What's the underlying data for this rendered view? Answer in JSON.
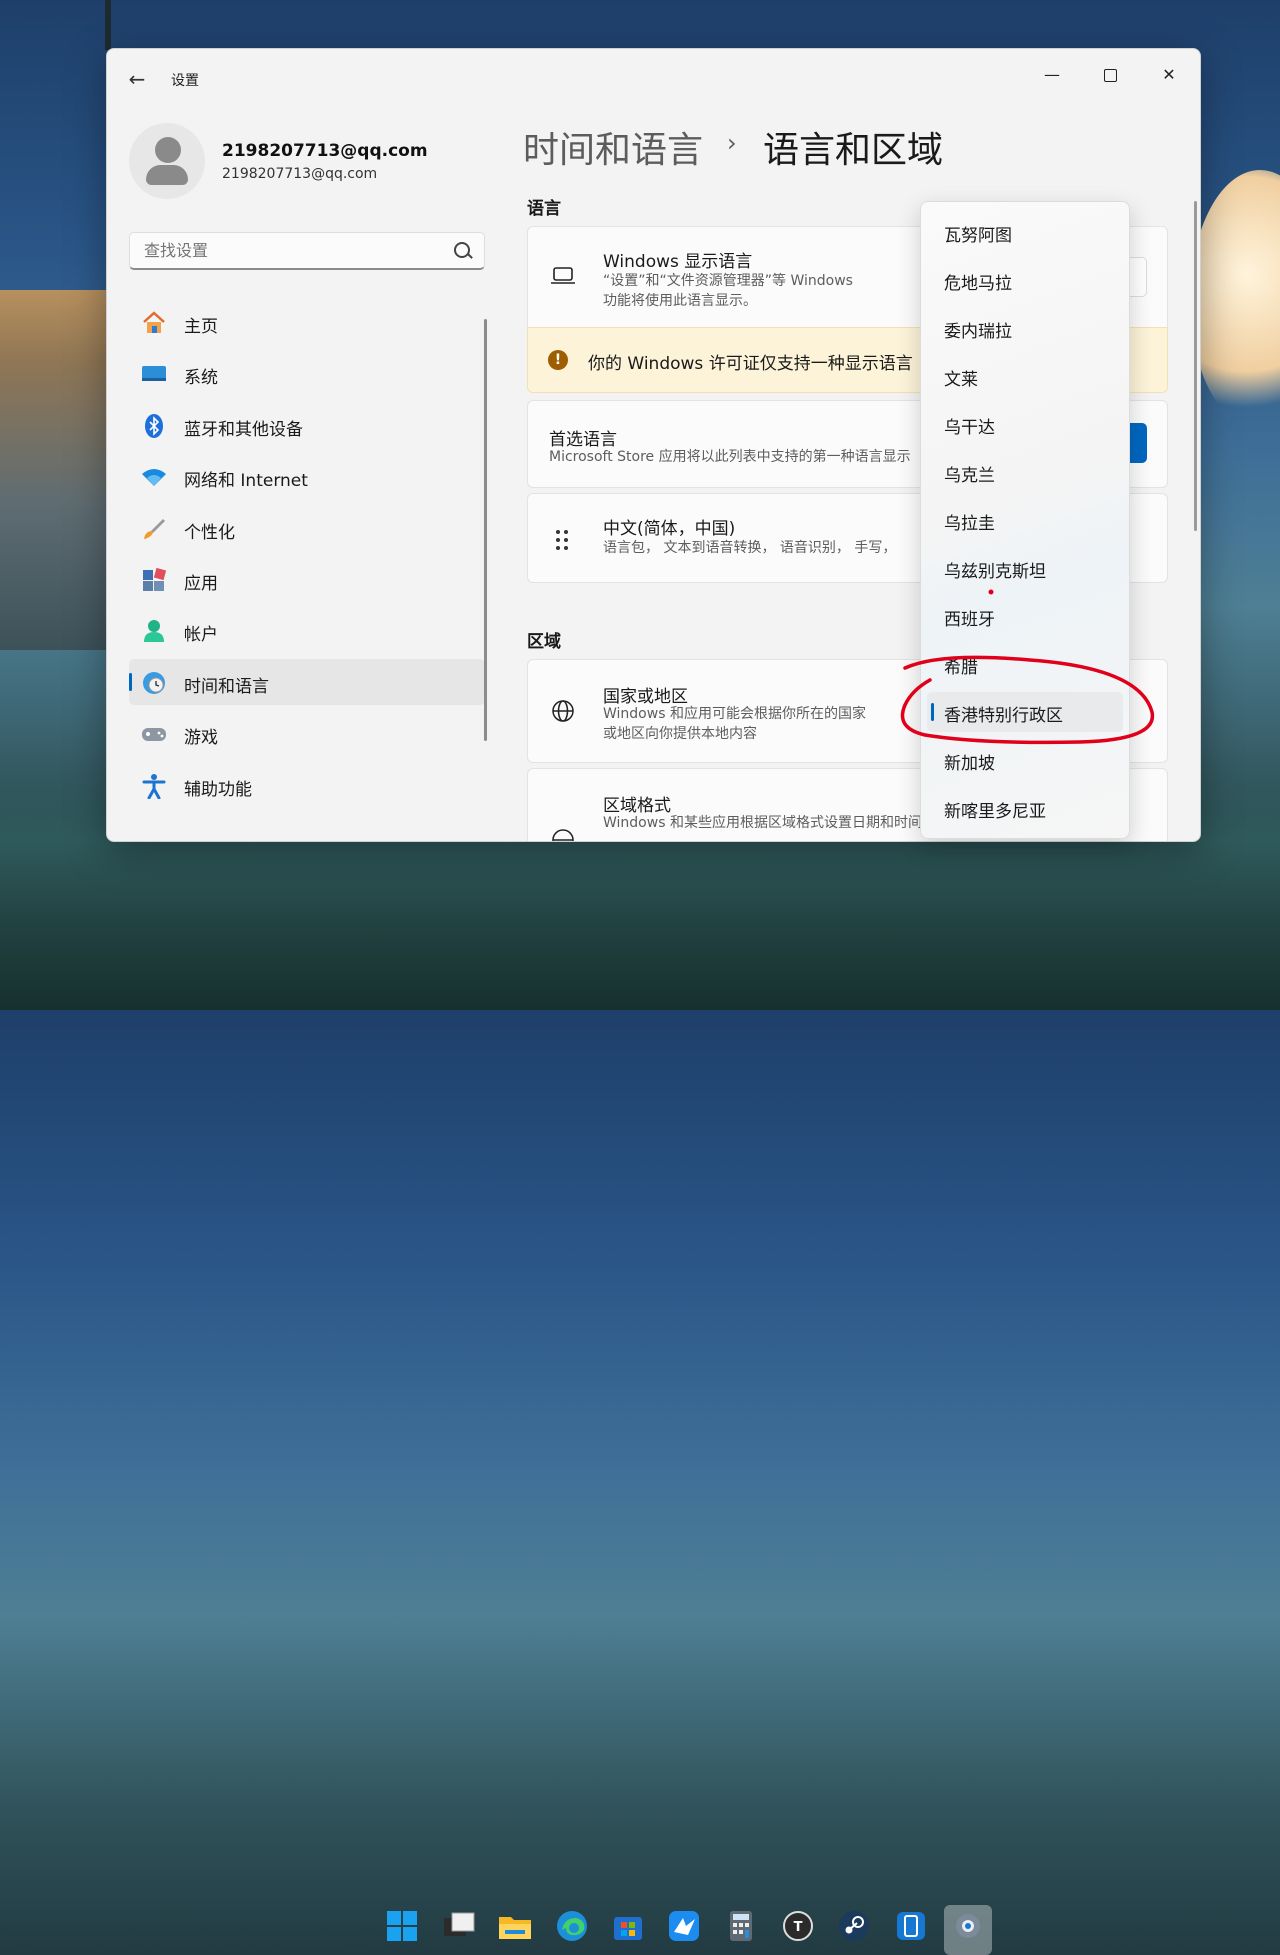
{
  "window": {
    "app_title": "设置"
  },
  "account": {
    "name": "2198207713@qq.com",
    "email": "2198207713@qq.com"
  },
  "search": {
    "placeholder": "查找设置"
  },
  "nav": {
    "items": [
      {
        "label": "主页",
        "icon": "home-icon"
      },
      {
        "label": "系统",
        "icon": "system-icon"
      },
      {
        "label": "蓝牙和其他设备",
        "icon": "bluetooth-icon"
      },
      {
        "label": "网络和 Internet",
        "icon": "wifi-icon"
      },
      {
        "label": "个性化",
        "icon": "brush-icon"
      },
      {
        "label": "应用",
        "icon": "apps-icon"
      },
      {
        "label": "帐户",
        "icon": "account-icon"
      },
      {
        "label": "时间和语言",
        "icon": "time-language-icon",
        "active": true
      },
      {
        "label": "游戏",
        "icon": "gamepad-icon"
      },
      {
        "label": "辅助功能",
        "icon": "accessibility-icon"
      }
    ]
  },
  "breadcrumb": {
    "parent": "时间和语言",
    "separator": "›",
    "current": "语言和区域"
  },
  "language": {
    "section_title": "语言",
    "display": {
      "title": "Windows 显示语言",
      "desc_line1": "“设置”和“文件资源管理器”等 Windows",
      "desc_line2": "功能将使用此语言显示。"
    },
    "warning": "你的 Windows 许可证仅支持一种显示语言",
    "preferred": {
      "title": "首选语言",
      "desc": "Microsoft Store 应用将以此列表中支持的第一种语言显示"
    },
    "chinese": {
      "title": "中文(简体，中国)",
      "desc": "语言包，  文本到语音转换，  语音识别，  手写，"
    }
  },
  "region": {
    "section_title": "区域",
    "country": {
      "title": "国家或地区",
      "desc_line1": "Windows 和应用可能会根据你所在的国家",
      "desc_line2": "或地区向你提供本地内容"
    },
    "format": {
      "title": "区域格式",
      "desc": "Windows 和某些应用根据区域格式设置日期和时间格式"
    }
  },
  "dropdown": {
    "items": [
      "瓦努阿图",
      "危地马拉",
      "委内瑞拉",
      "文莱",
      "乌干达",
      "乌克兰",
      "乌拉圭",
      "乌兹别克斯坦",
      "西班牙",
      "希腊",
      "香港特别行政区",
      "新加坡",
      "新喀里多尼亚"
    ],
    "selected": "香港特别行政区"
  },
  "colors": {
    "accent": "#0067c0",
    "warning_bg": "#fcf3d8",
    "annotation": "#e0001a"
  },
  "taskbar": {
    "apps": [
      "start-icon",
      "task-view-icon",
      "file-explorer-icon",
      "edge-icon",
      "store-icon",
      "bird-app-icon",
      "calculator-icon",
      "typora-icon",
      "steam-icon",
      "phone-link-icon",
      "settings-icon"
    ]
  }
}
